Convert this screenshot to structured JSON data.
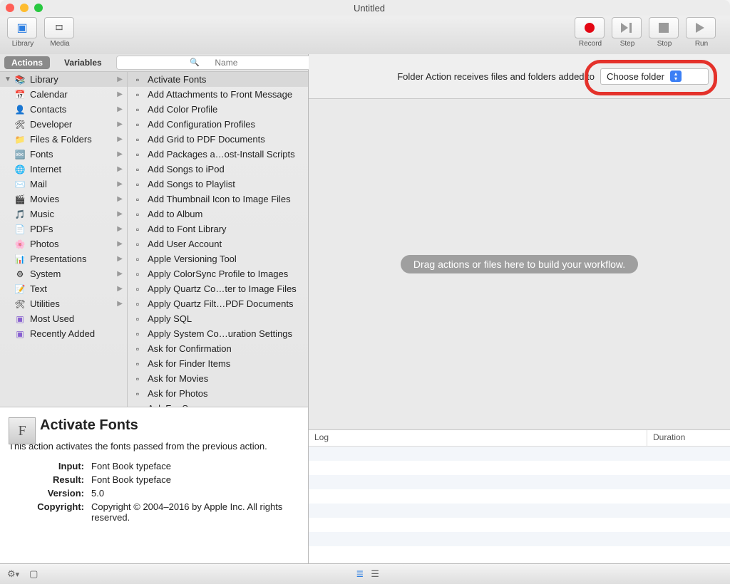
{
  "window": {
    "title": "Untitled"
  },
  "toolbar": {
    "library": "Library",
    "media": "Media",
    "record": "Record",
    "step": "Step",
    "stop": "Stop",
    "run": "Run"
  },
  "tabs": {
    "actions": "Actions",
    "variables": "Variables"
  },
  "search": {
    "placeholder": "Name"
  },
  "library": {
    "root": "Library",
    "children": [
      "Calendar",
      "Contacts",
      "Developer",
      "Files & Folders",
      "Fonts",
      "Internet",
      "Mail",
      "Movies",
      "Music",
      "PDFs",
      "Photos",
      "Presentations",
      "System",
      "Text",
      "Utilities"
    ],
    "smart": [
      "Most Used",
      "Recently Added"
    ]
  },
  "actions": [
    "Activate Fonts",
    "Add Attachments to Front Message",
    "Add Color Profile",
    "Add Configuration Profiles",
    "Add Grid to PDF Documents",
    "Add Packages a…ost-Install Scripts",
    "Add Songs to iPod",
    "Add Songs to Playlist",
    "Add Thumbnail Icon to Image Files",
    "Add to Album",
    "Add to Font Library",
    "Add User Account",
    "Apple Versioning Tool",
    "Apply ColorSync Profile to Images",
    "Apply Quartz Co…ter to Image Files",
    "Apply Quartz Filt…PDF Documents",
    "Apply SQL",
    "Apply System Co…uration Settings",
    "Ask for Confirmation",
    "Ask for Finder Items",
    "Ask for Movies",
    "Ask for Photos",
    "Ask For Servers"
  ],
  "info": {
    "title": "Activate Fonts",
    "desc": "This action activates the fonts passed from the previous action.",
    "input_k": "Input:",
    "input_v": "Font Book typeface",
    "result_k": "Result:",
    "result_v": "Font Book typeface",
    "version_k": "Version:",
    "version_v": "5.0",
    "copyright_k": "Copyright:",
    "copyright_v": "Copyright © 2004–2016 by Apple Inc. All rights reserved."
  },
  "workflow": {
    "param_label": "Folder Action receives files and folders added to",
    "popup_value": "Choose folder",
    "placeholder": "Drag actions or files here to build your workflow."
  },
  "log": {
    "col1": "Log",
    "col2": "Duration"
  }
}
